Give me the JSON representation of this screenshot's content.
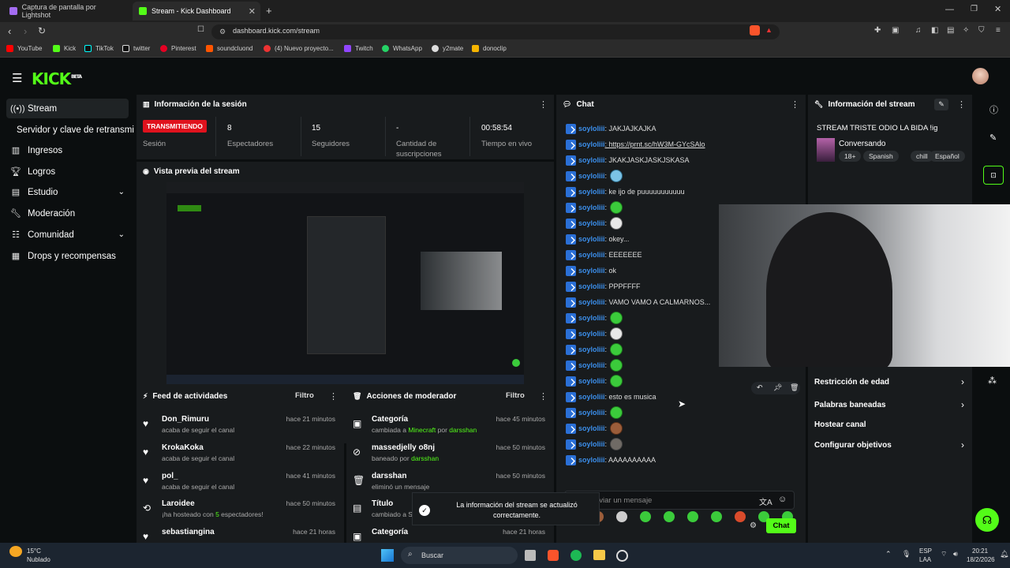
{
  "browser": {
    "tabs": [
      {
        "title": "Captura de pantalla por Lightshot"
      },
      {
        "title": "Stream - Kick Dashboard"
      }
    ],
    "url": "dashboard.kick.com/stream",
    "bookmarks": [
      "YouTube",
      "Kick",
      "TikTok",
      "twitter",
      "Pinterest",
      "soundcluond",
      "(4) Nuevo proyecto...",
      "Twitch",
      "WhatsApp",
      "y2mate",
      "donoclip"
    ]
  },
  "logo": {
    "text": "KICK",
    "beta": "BETA"
  },
  "sidebar": {
    "items": [
      {
        "label": "Stream",
        "icon": "broadcast-icon"
      },
      {
        "label": "Servidor y clave de retransmi",
        "icon": ""
      },
      {
        "label": "Ingresos",
        "icon": "chart-icon"
      },
      {
        "label": "Logros",
        "icon": "trophy-icon"
      },
      {
        "label": "Estudio",
        "icon": "video-icon"
      },
      {
        "label": "Moderación",
        "icon": "wrench-icon"
      },
      {
        "label": "Comunidad",
        "icon": "people-icon"
      },
      {
        "label": "Drops y recompensas",
        "icon": "gift-icon"
      }
    ]
  },
  "session": {
    "title": "Información de la sesión",
    "status_badge": "TRANSMITIENDO",
    "status_label": "Sesión",
    "stats": [
      {
        "value": "8",
        "label": "Espectadores"
      },
      {
        "value": "15",
        "label": "Seguidores"
      },
      {
        "value": "-",
        "label": "Cantidad de suscripciones"
      },
      {
        "value": "00:58:54",
        "label": "Tiempo en vivo"
      }
    ]
  },
  "preview": {
    "title": "Vista previa del stream"
  },
  "feed": {
    "title": "Feed de actividades",
    "filter": "Filtro",
    "rows": [
      {
        "name": "Don_Rimuru",
        "sub": "acaba de seguir el canal",
        "time": "hace 21 minutos"
      },
      {
        "name": "KrokaKoka",
        "sub": "acaba de seguir el canal",
        "time": "hace 22 minutos"
      },
      {
        "name": "pol_",
        "sub": "acaba de seguir el canal",
        "time": "hace 41 minutos"
      },
      {
        "name": "Laroidee",
        "sub_a": "¡ha hosteado con ",
        "sub_b": "5",
        "sub_c": " espectadores!",
        "time": "hace 50 minutos"
      },
      {
        "name": "sebastiangina",
        "sub": "",
        "time": "hace 21 horas"
      }
    ]
  },
  "modactions": {
    "title": "Acciones de moderador",
    "filter": "Filtro",
    "rows": [
      {
        "name": "Categoría",
        "sub_a": "cambiada a ",
        "sub_b": "Minecraft",
        "sub_c": " por ",
        "sub_d": "darsshan",
        "time": "hace 45 minutos"
      },
      {
        "name": "massedjelly o8nj",
        "sub_a": "baneado por ",
        "sub_b": "darsshan",
        "time": "hace 50 minutos"
      },
      {
        "name": "darsshan",
        "sub_a": "eliminó un mensaje",
        "time": "hace 50 minutos"
      },
      {
        "name": "Título",
        "sub_a": "cambiado a S",
        "time": ""
      },
      {
        "name": "Categoría",
        "sub_a": "",
        "time": "hace 21 horas"
      }
    ]
  },
  "chat": {
    "title": "Chat",
    "username": "soyloliii",
    "messages": [
      {
        "text": ": JAKJAJKAJKA"
      },
      {
        "text": ": https://prnt.sc/hW3M-GYcSAlo",
        "link": true
      },
      {
        "text": ": JKAKJASKJASKJSKASA"
      },
      {
        "text": ":",
        "emote": "t"
      },
      {
        "text": ": ke ijo de puuuuuuuuuuu"
      },
      {
        "text": ":",
        "emote": "g"
      },
      {
        "text": ":",
        "emote": "w"
      },
      {
        "text": ": okey..."
      },
      {
        "text": ": EEEEEEE"
      },
      {
        "text": ": ok"
      },
      {
        "text": ": PPPFFFF"
      },
      {
        "text": ": VAMO VAMO A CALMARNOS..."
      },
      {
        "text": ":",
        "emote": "g"
      },
      {
        "text": ":",
        "emote": "w"
      },
      {
        "text": ":",
        "emote": "g"
      },
      {
        "text": ":",
        "emote": "g"
      },
      {
        "text": ":",
        "emote": "g"
      },
      {
        "text": ": esto es musica"
      },
      {
        "text": ":",
        "emote": "g"
      },
      {
        "text": ":",
        "emote": "m"
      },
      {
        "text": ":",
        "emote": "b"
      },
      {
        "text": ": AAAAAAAAAA"
      }
    ],
    "input_placeholder": "nviar un mensaje",
    "send_label": "Chat"
  },
  "streaminfo": {
    "title": "Información del stream",
    "stream_title": "STREAM TRISTE ODIO LA BIDA !ig",
    "category": "Conversando",
    "tags": [
      "18+",
      "Spanish",
      "chill",
      "Español"
    ],
    "links": [
      "Restricción de edad",
      "Palabras baneadas",
      "Hostear canal",
      "Configurar objetivos"
    ]
  },
  "toast": {
    "text": "La información del stream se actualizó correctamente."
  },
  "taskbar": {
    "weather_temp": "15°C",
    "weather_desc": "Nublado",
    "search": "Buscar",
    "lang": "ESP",
    "lang2": "LAA",
    "time": "20:21",
    "date": "18/2/2026"
  },
  "colors": {
    "kick_green": "#53fc18",
    "live_red": "#e0121d",
    "user_blue": "#3b8eea",
    "panel_bg": "#181b1d"
  }
}
